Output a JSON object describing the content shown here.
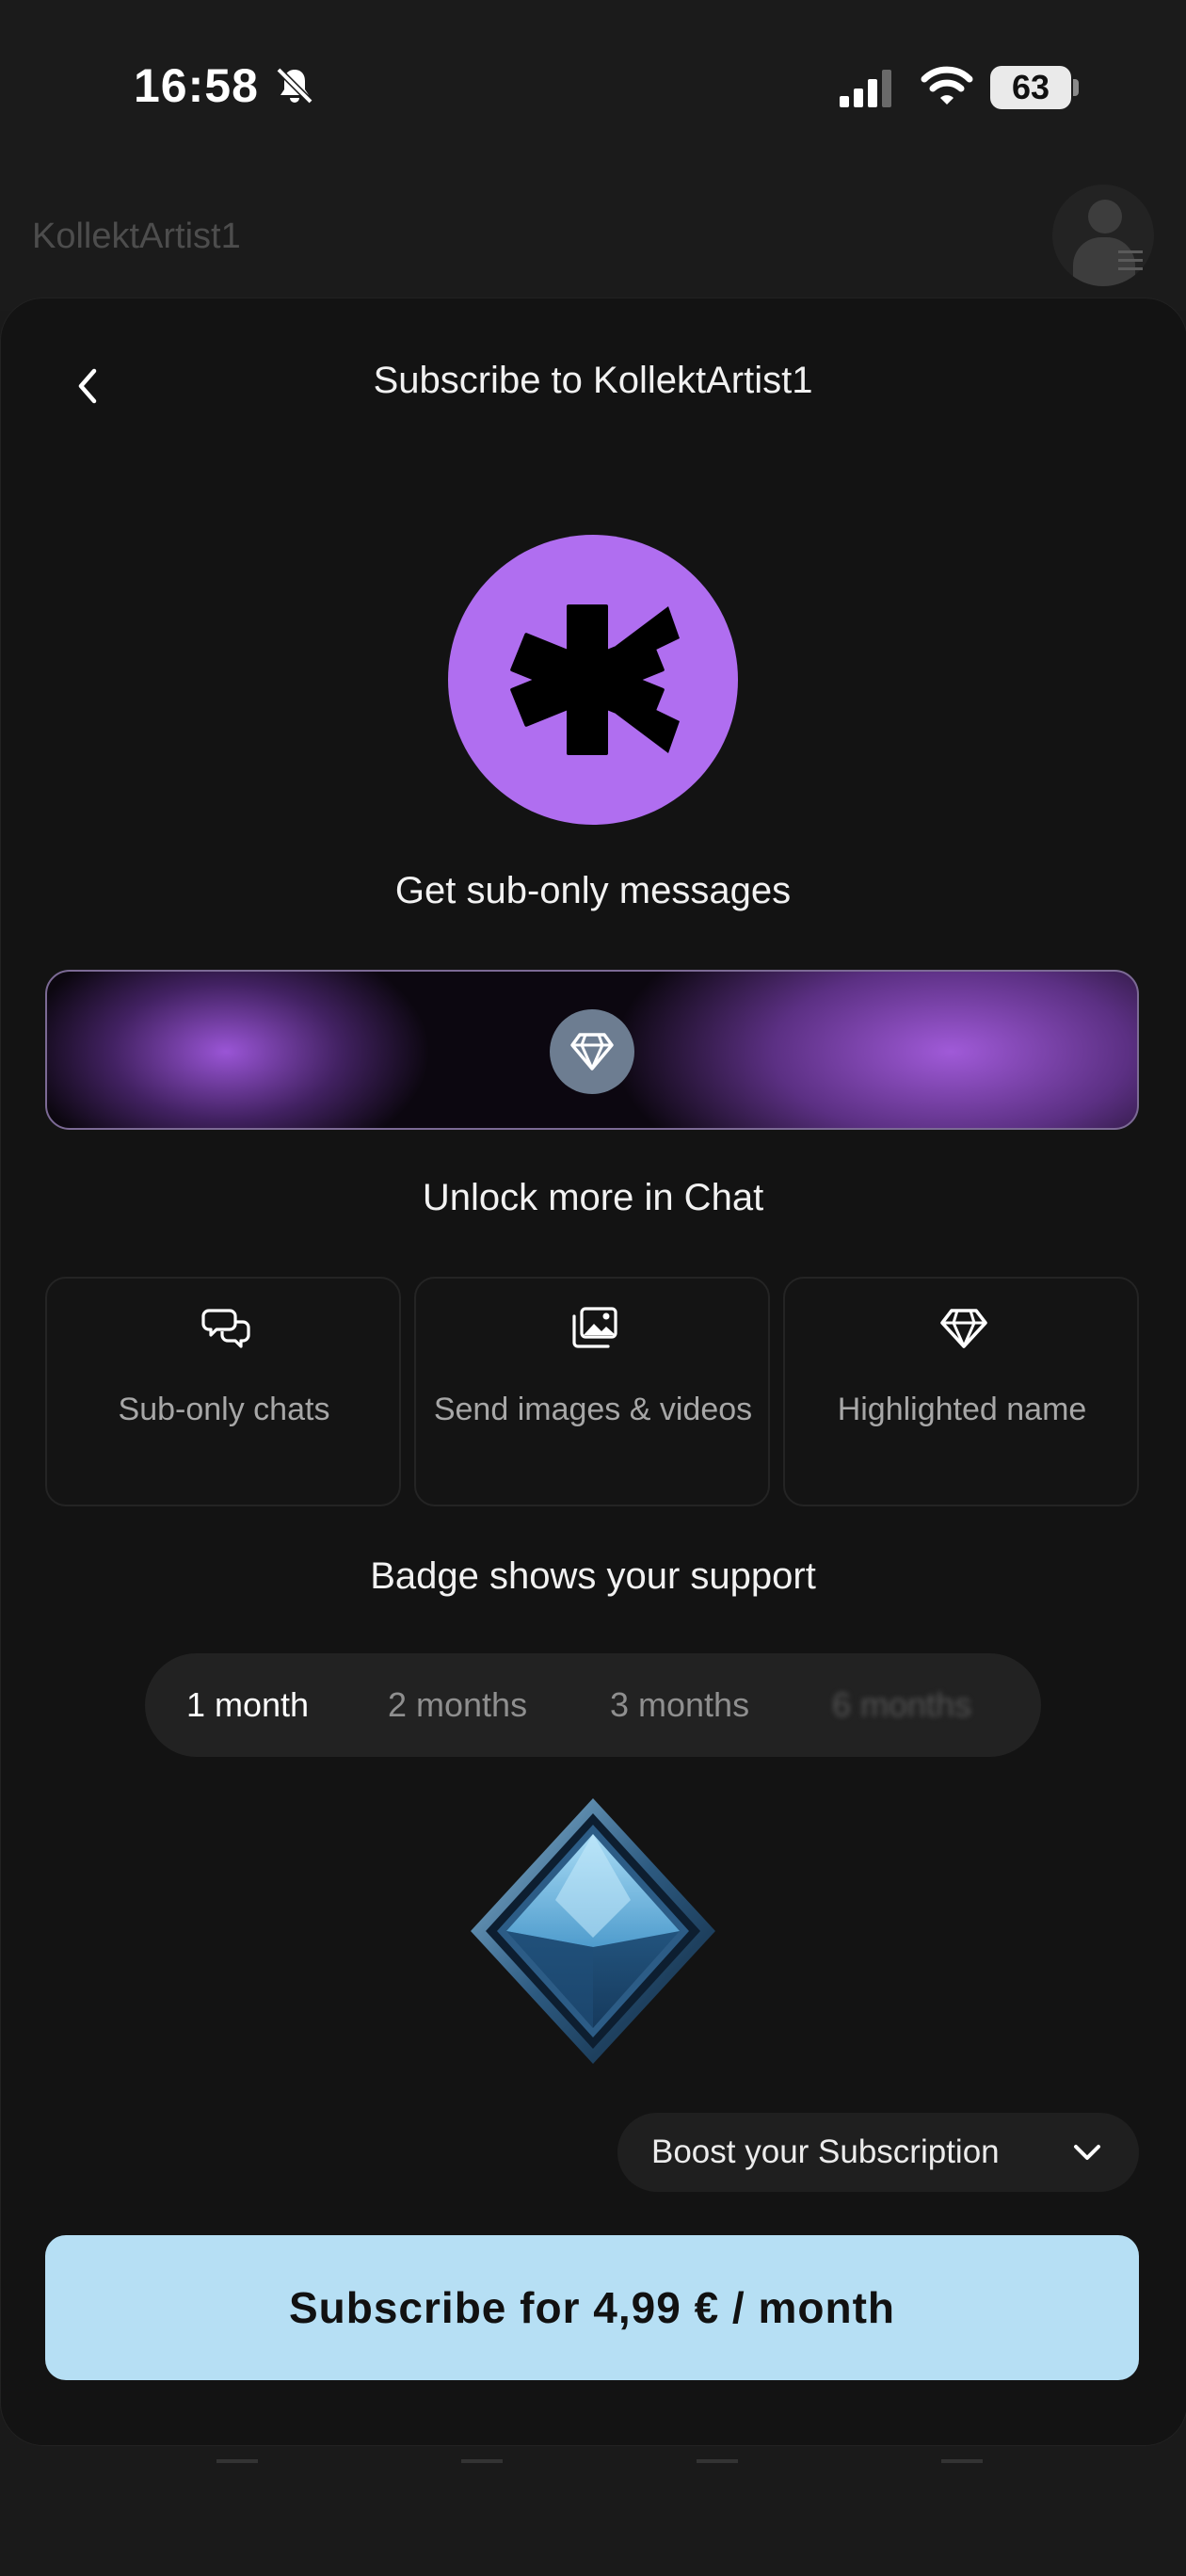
{
  "status_bar": {
    "time": "16:58",
    "battery": "63"
  },
  "background": {
    "title": "KollektArtist1"
  },
  "sheet": {
    "title": "Subscribe to KollektArtist1"
  },
  "hero": {
    "caption": "Get sub-only messages",
    "logo_color": "#b06ef0"
  },
  "chat": {
    "heading": "Unlock more in Chat",
    "features": [
      {
        "label": "Sub-only chats",
        "icon": "chat-bubbles-icon"
      },
      {
        "label": "Send images & videos",
        "icon": "images-icon"
      },
      {
        "label": "Highlighted name",
        "icon": "diamond-icon"
      }
    ]
  },
  "badge": {
    "heading": "Badge shows your support",
    "tabs": [
      {
        "label": "1 month",
        "active": true
      },
      {
        "label": "2 months",
        "active": false
      },
      {
        "label": "3 months",
        "active": false
      },
      {
        "label": "6 months",
        "active": false
      }
    ]
  },
  "boost": {
    "label": "Boost your Subscription"
  },
  "cta": {
    "label": "Subscribe for 4,99 € / month",
    "color": "#b6dff4"
  }
}
